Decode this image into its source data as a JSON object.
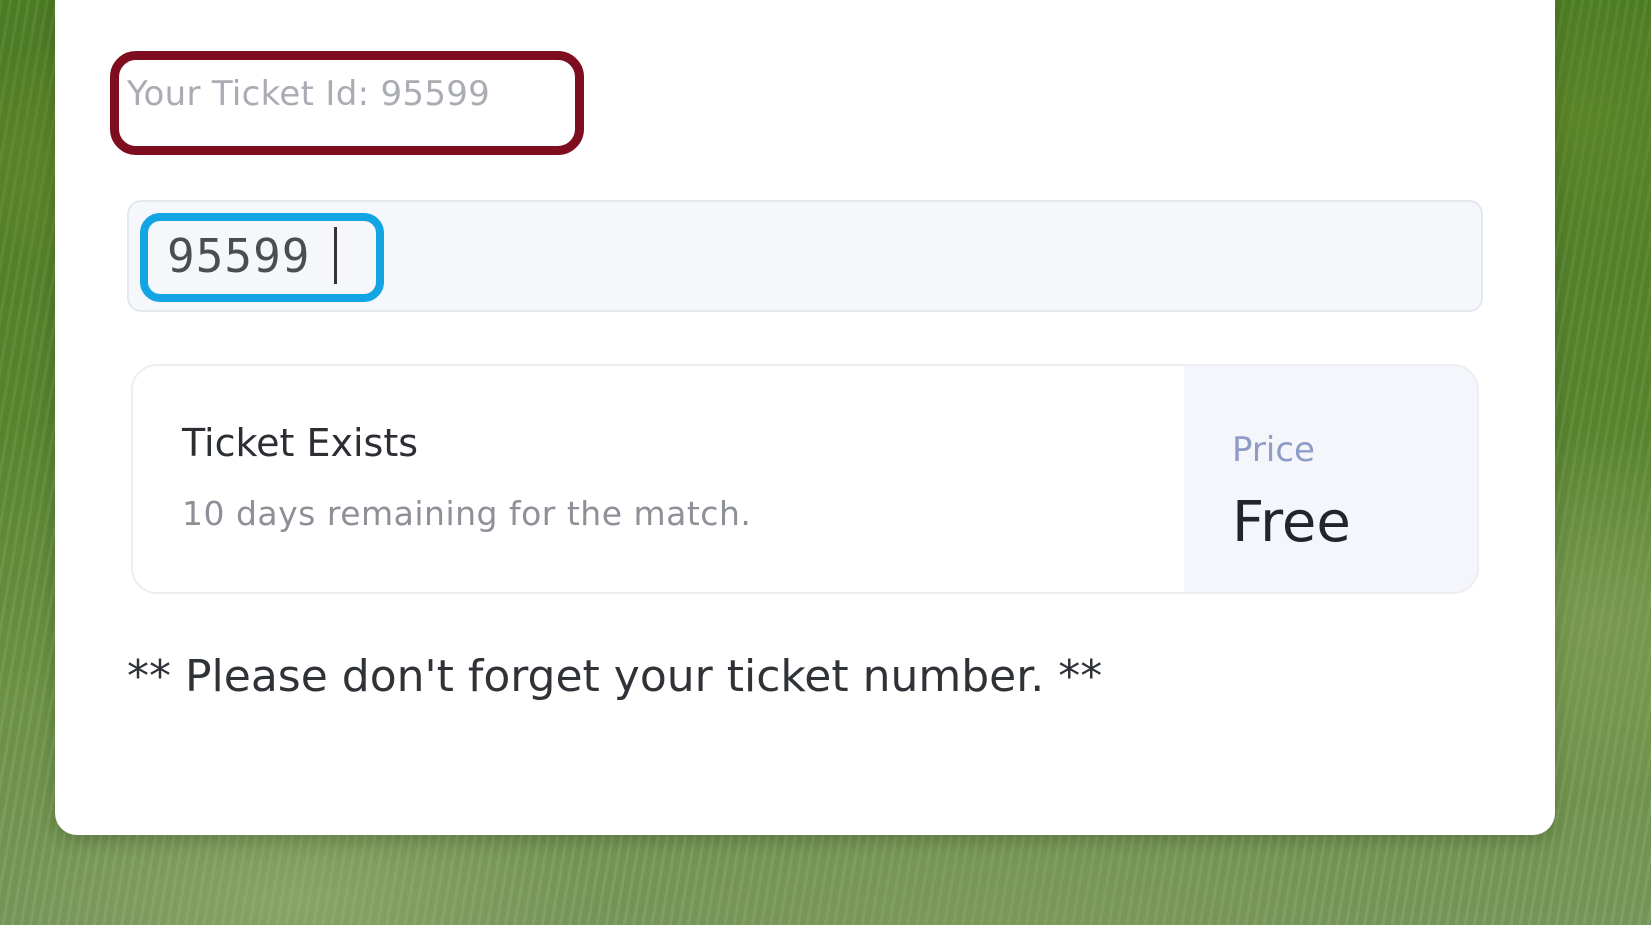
{
  "ticket": {
    "id_label": "Your Ticket Id: 95599",
    "input_value": "95599"
  },
  "status": {
    "title": "Ticket Exists",
    "subtitle": "10 days remaining for the match.",
    "price_label": "Price",
    "price_value": "Free"
  },
  "reminder": "** Please don't forget your ticket number. **",
  "colors": {
    "label_highlight": "#7e0d1f",
    "input_highlight": "#13a4e4",
    "card_background": "#ffffff",
    "price_label": "#8f9cc6"
  }
}
